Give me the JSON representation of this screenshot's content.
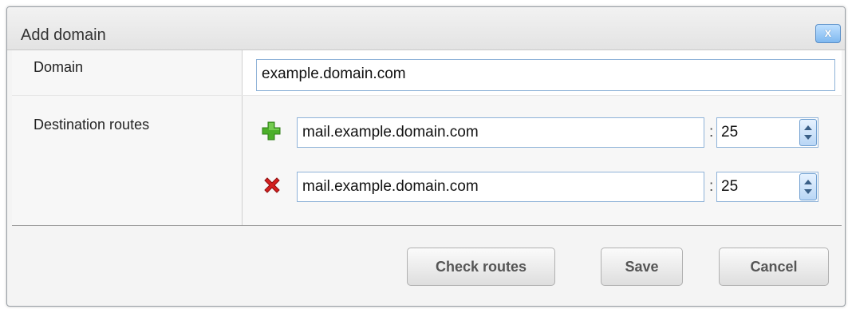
{
  "dialog": {
    "title": "Add domain",
    "close_label": "x"
  },
  "form": {
    "domain_label": "Domain",
    "domain_value": "example.domain.com",
    "routes_label": "Destination routes",
    "routes": [
      {
        "action_icon": "add-icon",
        "host": "mail.example.domain.com",
        "separator": ":",
        "port": "25"
      },
      {
        "action_icon": "remove-icon",
        "host": "mail.example.domain.com",
        "separator": ":",
        "port": "25"
      }
    ]
  },
  "footer": {
    "check_routes_label": "Check routes",
    "save_label": "Save",
    "cancel_label": "Cancel"
  },
  "colors": {
    "add_icon": "#4caf2a",
    "remove_icon": "#d42020",
    "input_border": "#8fb3d8"
  }
}
